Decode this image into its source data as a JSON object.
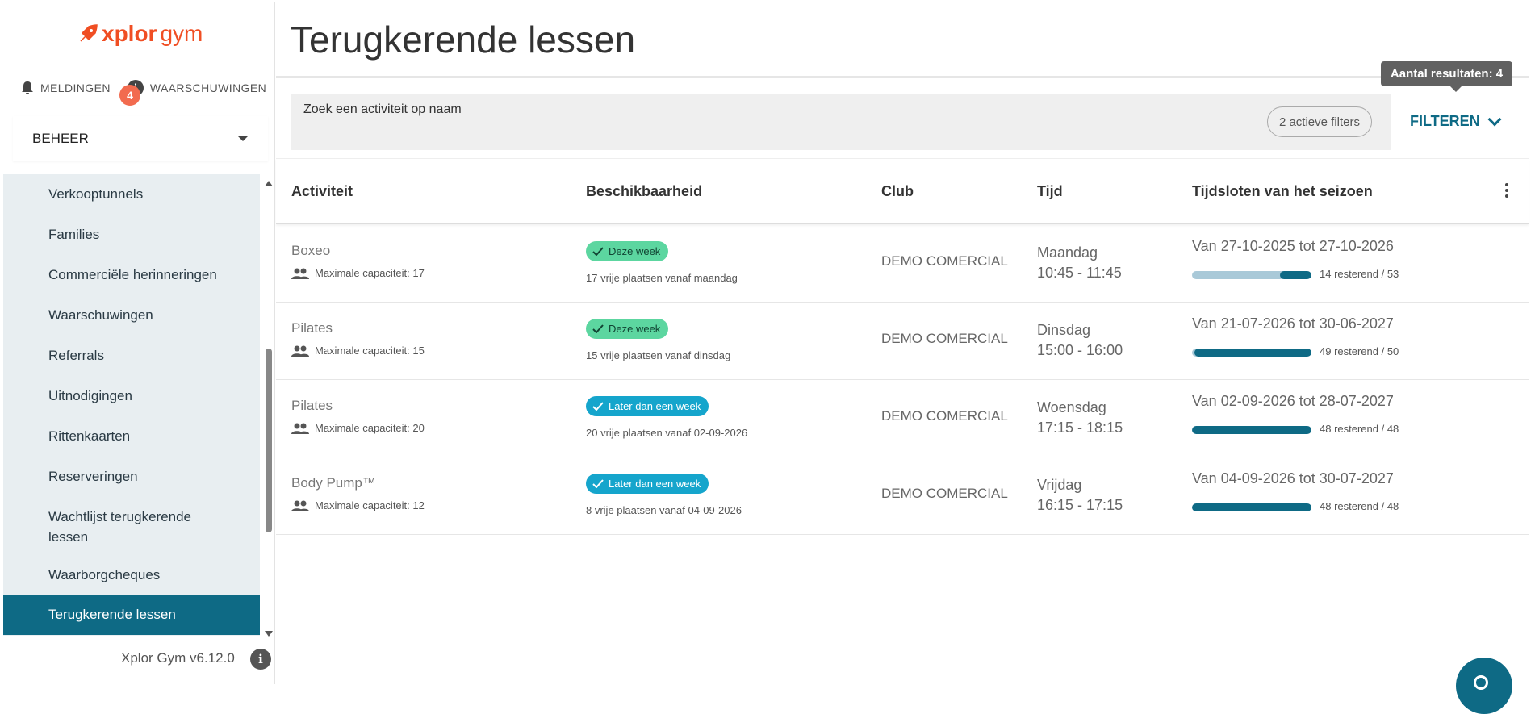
{
  "brand": {
    "name_x": "xplor",
    "name_gym": "gym",
    "color": "#f04e23"
  },
  "notifications": {
    "meldingen_label": "MELDINGEN",
    "waarschuwingen_label": "WAARSCHUWINGEN",
    "badge_count": "4"
  },
  "sidebar": {
    "section_label": "BEHEER",
    "items": [
      {
        "label": "Verkooptunnels"
      },
      {
        "label": "Families"
      },
      {
        "label": "Commerciële herinneringen"
      },
      {
        "label": "Waarschuwingen"
      },
      {
        "label": "Referrals"
      },
      {
        "label": "Uitnodigingen"
      },
      {
        "label": "Rittenkaarten"
      },
      {
        "label": "Reserveringen"
      },
      {
        "label": "Wachtlijst terugkerende lessen"
      },
      {
        "label": "Waarborgcheques"
      },
      {
        "label": "Terugkerende lessen",
        "active": true
      }
    ],
    "version": "Xplor Gym v6.12.0",
    "accent": "#0e6a85"
  },
  "page": {
    "title": "Terugkerende lessen",
    "tooltip": "Aantal resultaten: 4",
    "search_placeholder": "Zoek een activiteit op naam",
    "active_filters": "2 actieve filters",
    "filter_label": "FILTEREN"
  },
  "table": {
    "columns": [
      "Activiteit",
      "Beschikbaarheid",
      "Club",
      "Tijd",
      "Tijdsloten van het seizoen"
    ],
    "rows": [
      {
        "activity": "Boxeo",
        "capacity": "Maximale capaciteit: 17",
        "status": "Deze week",
        "status_type": "green",
        "availability": "17 vrije plaatsen vanaf maandag",
        "club": "DEMO COMERCIAL",
        "day": "Maandag",
        "time": "10:45 - 11:45",
        "range": "Van 27-10-2025 tot 27-10-2026",
        "remaining": "14 resterend / 53",
        "remaining_value": 14,
        "total": 53
      },
      {
        "activity": "Pilates",
        "capacity": "Maximale capaciteit: 15",
        "status": "Deze week",
        "status_type": "green",
        "availability": "15 vrije plaatsen vanaf dinsdag",
        "club": "DEMO COMERCIAL",
        "day": "Dinsdag",
        "time": "15:00 - 16:00",
        "range": "Van 21-07-2026 tot 30-06-2027",
        "remaining": "49 resterend / 50",
        "remaining_value": 49,
        "total": 50
      },
      {
        "activity": "Pilates",
        "capacity": "Maximale capaciteit: 20",
        "status": "Later dan een week",
        "status_type": "teal",
        "availability": "20 vrije plaatsen vanaf 02-09-2026",
        "club": "DEMO COMERCIAL",
        "day": "Woensdag",
        "time": "17:15 - 18:15",
        "range": "Van 02-09-2026 tot 28-07-2027",
        "remaining": "48 resterend / 48",
        "remaining_value": 48,
        "total": 48
      },
      {
        "activity": "Body Pump™",
        "capacity": "Maximale capaciteit: 12",
        "status": "Later dan een week",
        "status_type": "teal",
        "availability": "8 vrije plaatsen vanaf 04-09-2026",
        "club": "DEMO COMERCIAL",
        "day": "Vrijdag",
        "time": "16:15 - 17:15",
        "range": "Van 04-09-2026 tot 30-07-2027",
        "remaining": "48 resterend / 48",
        "remaining_value": 48,
        "total": 48
      }
    ]
  }
}
